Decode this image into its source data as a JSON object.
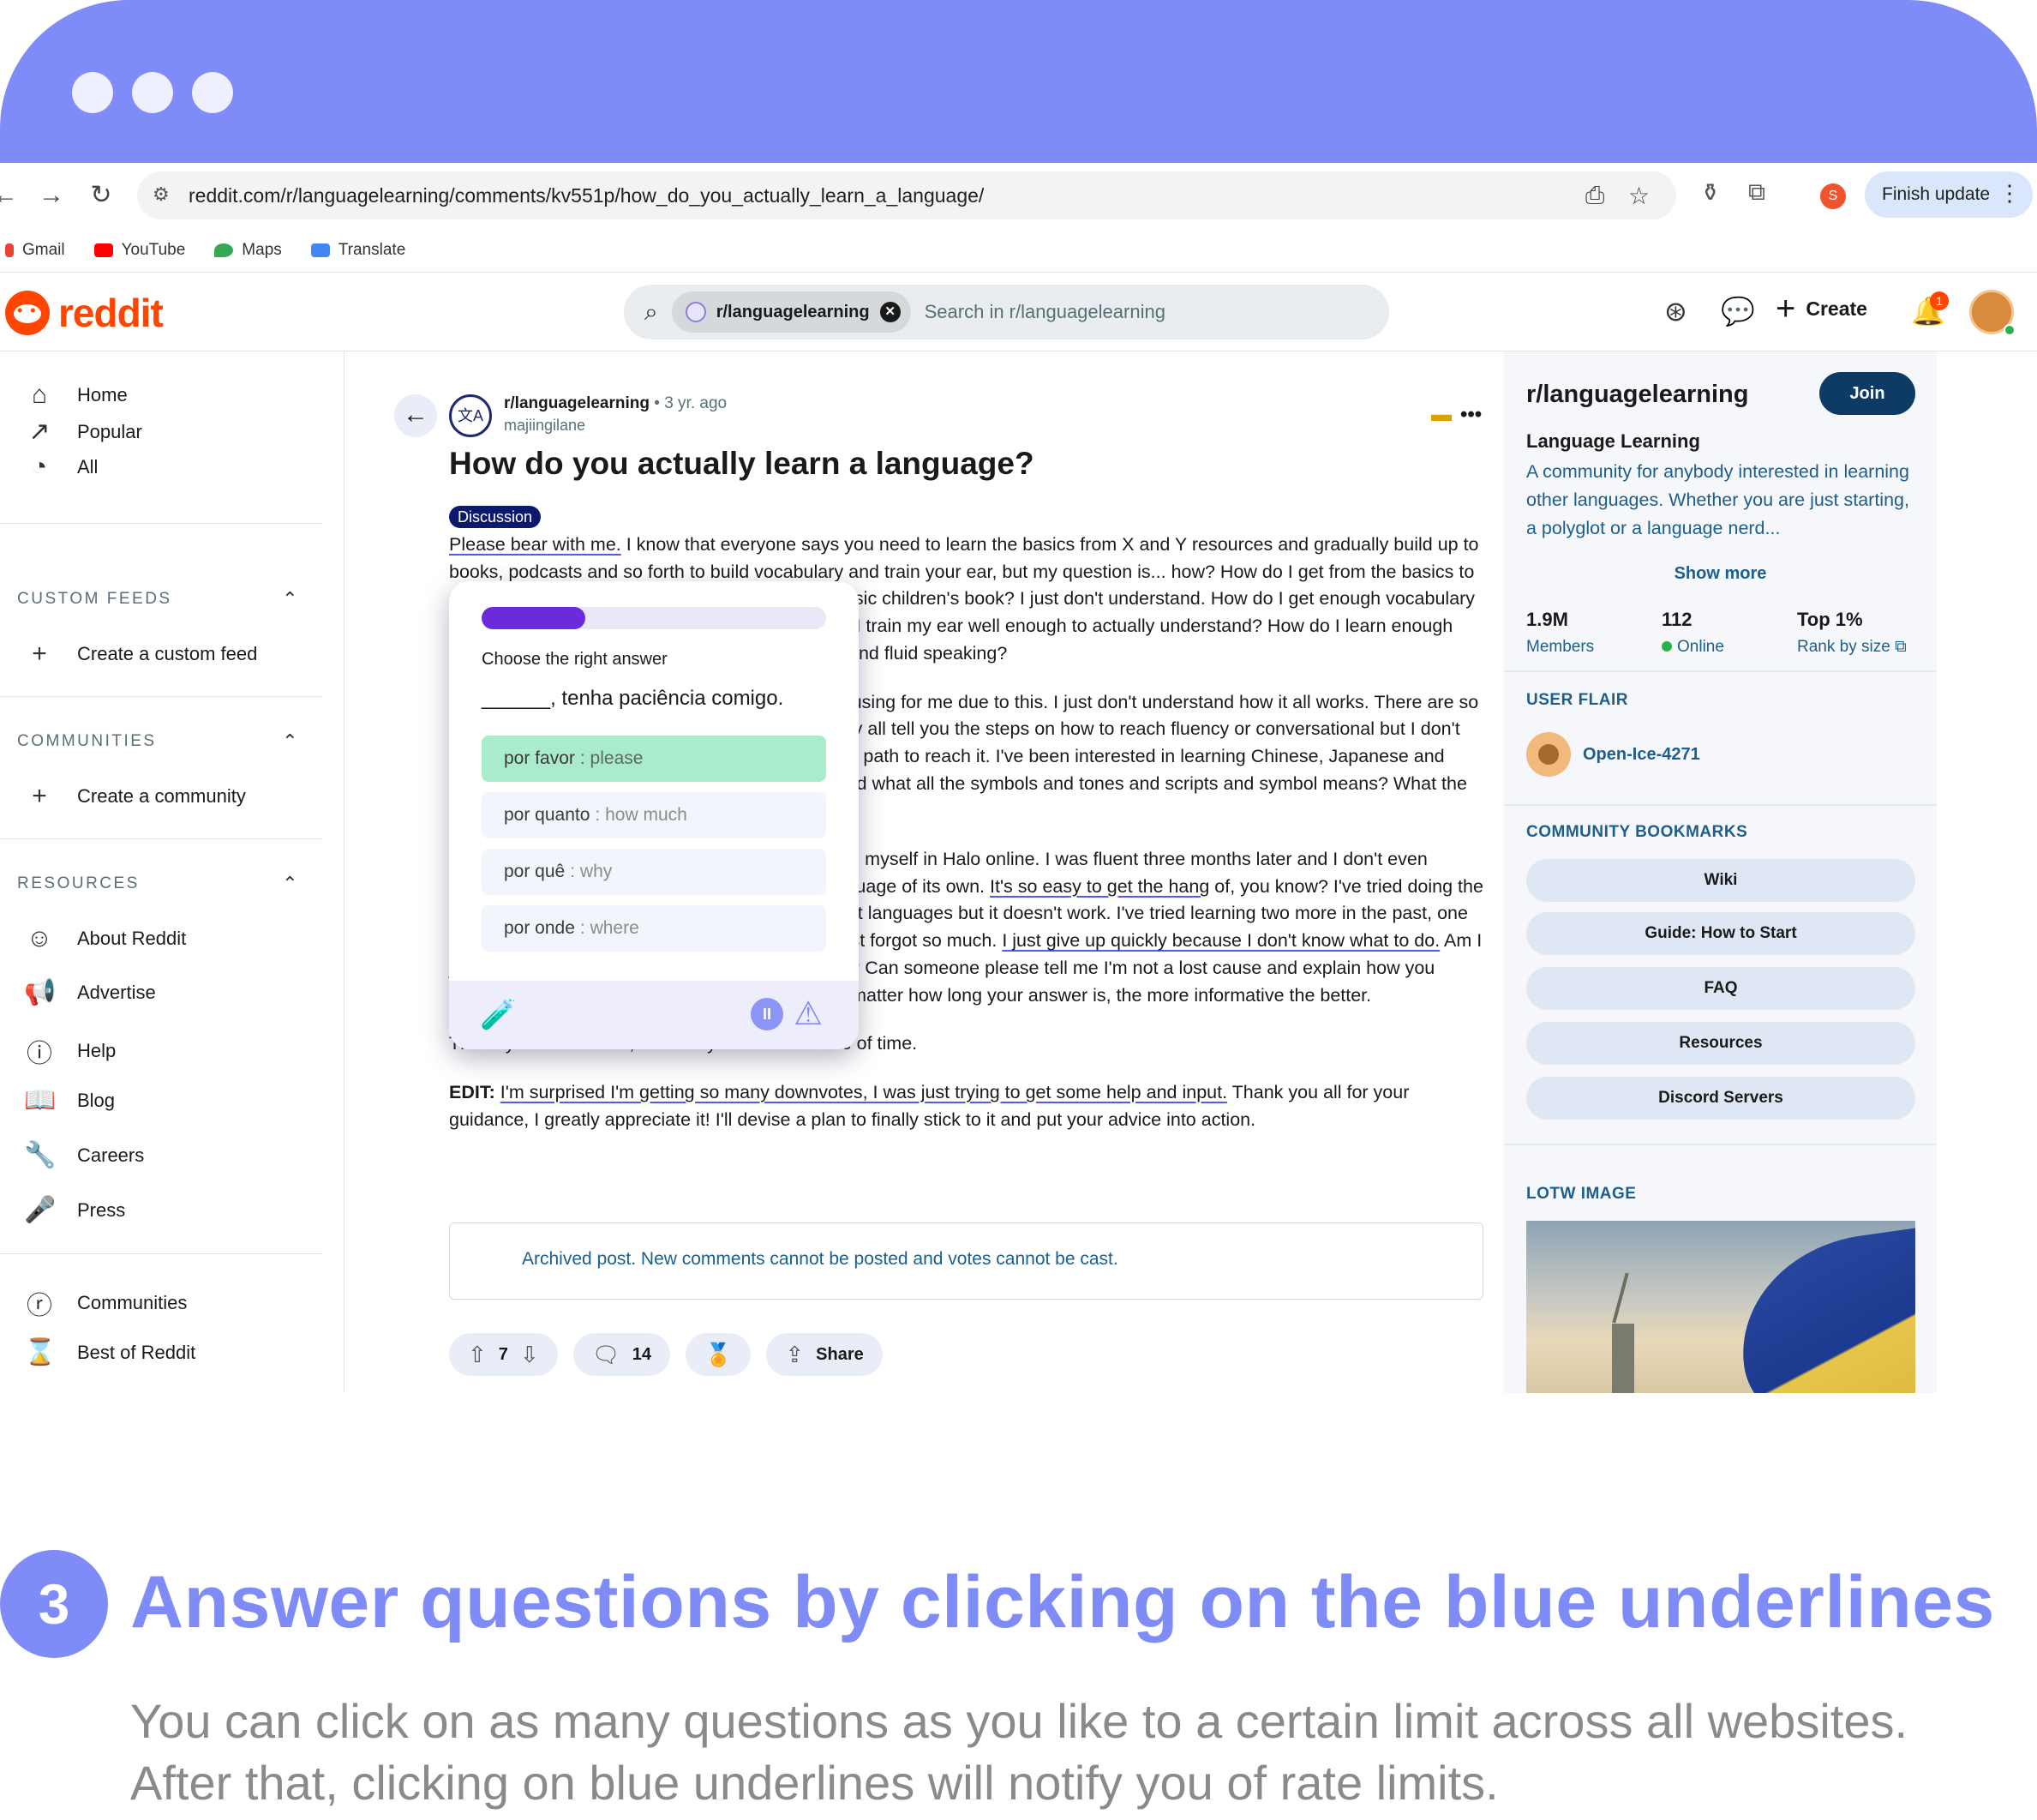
{
  "browser": {
    "url": "reddit.com/r/languagelearning/comments/kv551p/how_do_you_actually_learn_a_language/",
    "profile_initial": "S",
    "finish_update_label": "Finish update",
    "bookmarks": [
      {
        "label": "Gmail",
        "color": "#ea4335"
      },
      {
        "label": "YouTube",
        "color": "#ff0000"
      },
      {
        "label": "Maps",
        "color": "#34a853"
      },
      {
        "label": "Translate",
        "color": "#4285f4"
      }
    ]
  },
  "header": {
    "logo_text": "reddit",
    "search_chip": "r/languagelearning",
    "search_placeholder": "Search in r/languagelearning",
    "create_label": "Create",
    "notification_count": "1"
  },
  "left_nav": {
    "top_items": [
      {
        "label": "Home",
        "icon": "home-icon"
      },
      {
        "label": "Popular",
        "icon": "popular-icon"
      },
      {
        "label": "All",
        "icon": "all-icon"
      }
    ],
    "custom_feeds_header": "CUSTOM FEEDS",
    "create_custom_feed": "Create a custom feed",
    "communities_header": "COMMUNITIES",
    "create_community": "Create a community",
    "resources_header": "RESOURCES",
    "resources": [
      {
        "label": "About Reddit"
      },
      {
        "label": "Advertise"
      },
      {
        "label": "Help"
      },
      {
        "label": "Blog"
      },
      {
        "label": "Careers"
      },
      {
        "label": "Press"
      }
    ],
    "bottom_items": [
      {
        "label": "Communities"
      },
      {
        "label": "Best of Reddit"
      }
    ]
  },
  "post": {
    "subreddit": "r/languagelearning",
    "age": "• 3 yr. ago",
    "author": "majiingilane",
    "title": "How do you actually learn a language?",
    "flair": "Discussion",
    "p1_link": "Please bear with me.",
    "p1_a": " I know that everyone says you need to learn the basics from X and Y resources and gradually build up to books, podcasts and so forth to build vocabulary and train your ear, but my question is... how? How do I get from the basics to understanding a podcast, TV show and even a basic children's book? I just don't understand. How do I get enough vocabulary to actually hold a conversation or speak? How do I train my ear well enough to actually understand? How do I learn enough grammar rules to start forming proper sentences and fluid speaking?",
    "p2": "My language learning journey has been very confusing for me due to this. I just don't understand how it all works. There are so many resources and articles available online. They all tell you the steps on how to reach fluency or conversational but I don't understand how you're supposed to even walk the path to reach it. I've been interested in learning Chinese, Japanese and Arabic. How on Earth am I supposed to understand what all the symbols and tones and scripts and symbol means? What the hell!",
    "p3_a": "I learned English as a child by basically immersing myself in Halo online. I was fluent three months later and I don't even remember the process. I feel like English is a language of its own. ",
    "p3_link1": "It's so easy to get the hang",
    "p3_b": " of, you know? I've tried doing the same process I did for English with my other target languages but it doesn't work. I've tried learning two more in the past, one which is SO close to my native language, and I just forgot so much. ",
    "p3_link2": "I just give up quickly because I don't know what to do.",
    "p3_c": " Am I just going to fail every time I try a language again? Can someone please tell me I'm not a lost cause and explain how you managed to actually learn a language? It doesn't matter how long your answer is, the more informative the better.",
    "p4": "Thank you in advance, and sorry if this is a waste of time.",
    "edit_label": "EDIT:",
    "edit_link": "I'm surprised I'm getting so many downvotes, I was just trying to get some help and input.",
    "edit_rest": " Thank you all for your guidance, I greatly appreciate it! I'll devise a plan to finally stick to it and put your advice into action.",
    "archived_notice": "Archived post. New comments cannot be posted and votes cannot be cast.",
    "votes": "7",
    "comments": "14",
    "share_label": "Share"
  },
  "quiz": {
    "progress": 0.3,
    "label": "Choose the right answer",
    "prompt": "______, tenha paciência comigo.",
    "options": [
      {
        "word": "por favor",
        "translation": ": please",
        "correct": true
      },
      {
        "word": "por quanto",
        "translation": ": how much",
        "correct": false
      },
      {
        "word": "por quê",
        "translation": ": why",
        "correct": false
      },
      {
        "word": "por onde",
        "translation": ": where",
        "correct": false
      }
    ]
  },
  "sidebar": {
    "title": "r/languagelearning",
    "join_label": "Join",
    "subtitle": "Language Learning",
    "description": "A community for anybody interested in learning other languages. Whether you are just starting, a polyglot or a language nerd...",
    "show_more": "Show more",
    "members_value": "1.9M",
    "members_label": "Members",
    "online_value": "112",
    "online_label": "Online",
    "rank_value": "Top 1%",
    "rank_label": "Rank by size",
    "user_flair_header": "USER FLAIR",
    "user_flair_name": "Open-Ice-4271",
    "bookmarks_header": "COMMUNITY BOOKMARKS",
    "bookmarks": [
      "Wiki",
      "Guide: How to Start",
      "FAQ",
      "Resources",
      "Discord Servers"
    ],
    "lotw_header": "LOTW IMAGE"
  },
  "step": {
    "number": "3",
    "title": "Answer questions by clicking on the blue underlines",
    "description": "You can click on as many questions as you like to a certain limit across all websites. After that, clicking on blue underlines will notify you of rate limits."
  },
  "colors": {
    "accent": "#7f8cf8",
    "reddit_orange": "#ff4500",
    "correct_option": "#a8eccb",
    "link_underline": "#4b5bf4"
  }
}
